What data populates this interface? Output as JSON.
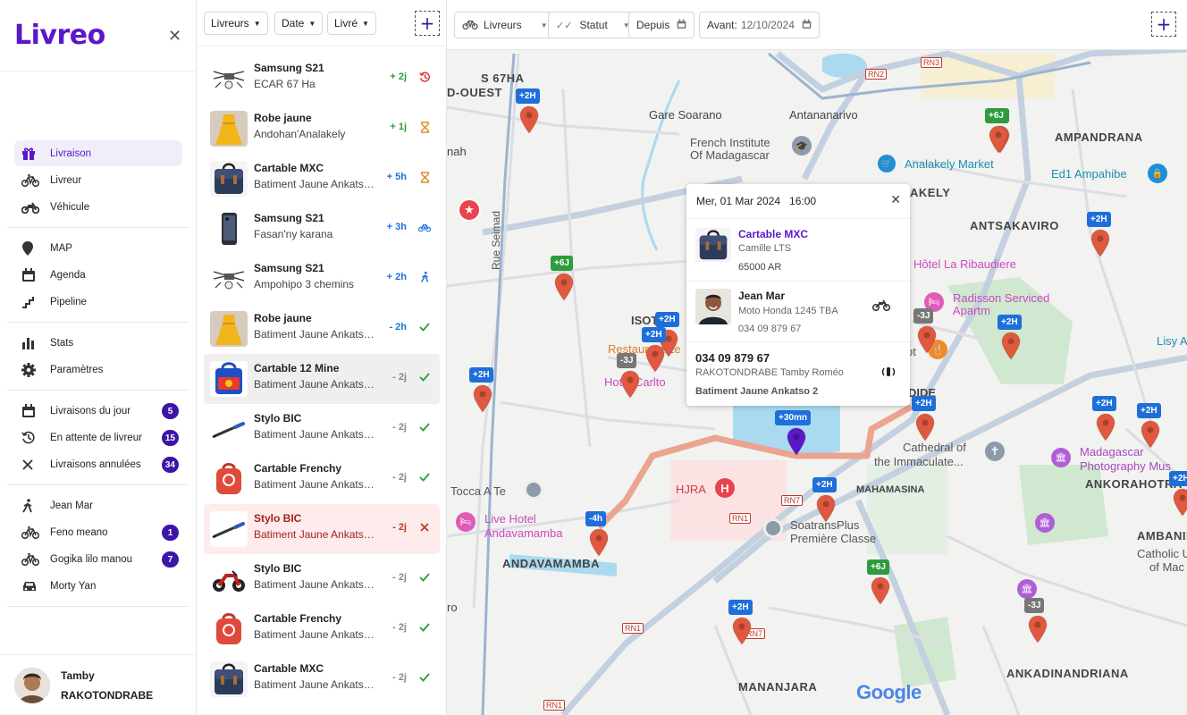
{
  "app": {
    "logo": "Livreo"
  },
  "sidebar": {
    "main": [
      {
        "label": "Livraison",
        "icon": "gift-icon",
        "active": true
      },
      {
        "label": "Livreur",
        "icon": "bicycle-icon"
      },
      {
        "label": "Véhicule",
        "icon": "motorbike-icon"
      }
    ],
    "tools": [
      {
        "label": "MAP",
        "icon": "map-pin-icon"
      },
      {
        "label": "Agenda",
        "icon": "calendar-icon"
      },
      {
        "label": "Pipeline",
        "icon": "pipeline-icon"
      }
    ],
    "settings": [
      {
        "label": "Stats",
        "icon": "bar-chart-icon"
      },
      {
        "label": "Paramètres",
        "icon": "gear-icon"
      }
    ],
    "queues": [
      {
        "label": "Livraisons du jour",
        "icon": "calendar-icon",
        "badge": "5"
      },
      {
        "label": "En attente de livreur",
        "icon": "history-icon",
        "badge": "15"
      },
      {
        "label": "Livraisons annulées",
        "icon": "close-icon",
        "badge": "34"
      }
    ],
    "couriers": [
      {
        "label": "Jean Mar",
        "icon": "walker-icon",
        "badge": ""
      },
      {
        "label": "Feno meano",
        "icon": "bicycle-icon",
        "badge": "1"
      },
      {
        "label": "Gogika lilo manou",
        "icon": "bicycle-icon",
        "badge": "7"
      },
      {
        "label": "Morty Yan",
        "icon": "car-icon",
        "badge": ""
      }
    ],
    "user": {
      "first": "Tamby",
      "last": "RAKOTONDRABE"
    }
  },
  "list_filters": {
    "livreurs": "Livreurs",
    "date": "Date",
    "livre": "Livré"
  },
  "deliveries": [
    {
      "title": "Samsung S21",
      "sub": "ECAR 67 Ha",
      "time": "+ 2j",
      "time_color": "#2e9b3c",
      "status": "history",
      "status_color": "#d33",
      "thumb": "drone"
    },
    {
      "title": "Robe jaune",
      "sub": "Andohan'Analakely",
      "time": "+ 1j",
      "time_color": "#2e9b3c",
      "status": "hourglass",
      "status_color": "#e08a2a",
      "thumb": "dress"
    },
    {
      "title": "Cartable MXC",
      "sub": "Batiment Jaune Ankatso 2",
      "time": "+ 5h",
      "time_color": "#1e6fd9",
      "status": "hourglass",
      "status_color": "#e08a2a",
      "thumb": "bag"
    },
    {
      "title": "Samsung S21",
      "sub": "Fasan'ny karana",
      "time": "+ 3h",
      "time_color": "#1e6fd9",
      "status": "bike",
      "status_color": "#1e6fd9",
      "thumb": "phone"
    },
    {
      "title": "Samsung S21",
      "sub": "Ampohipo 3 chemins",
      "time": "+ 2h",
      "time_color": "#1e6fd9",
      "status": "walk",
      "status_color": "#1e6fd9",
      "thumb": "drone"
    },
    {
      "title": "Robe jaune",
      "sub": "Batiment Jaune Ankatso 2",
      "time": "- 2h",
      "time_color": "#1e6fd9",
      "status": "check",
      "status_color": "#2e9b3c",
      "thumb": "dress"
    },
    {
      "title": "Cartable 12 Mine",
      "sub": "Batiment Jaune Ankatso 2",
      "time": "- 2j",
      "time_color": "#888",
      "status": "check",
      "status_color": "#2e9b3c",
      "thumb": "schoolbag",
      "selected": true
    },
    {
      "title": "Stylo BIC",
      "sub": "Batiment Jaune Ankatso 2",
      "time": "- 2j",
      "time_color": "#888",
      "status": "check",
      "status_color": "#2e9b3c",
      "thumb": "pen"
    },
    {
      "title": "Cartable Frenchy",
      "sub": "Batiment Jaune Ankatso 2",
      "time": "- 2j",
      "time_color": "#888",
      "status": "check",
      "status_color": "#2e9b3c",
      "thumb": "redbag"
    },
    {
      "title": "Stylo BIC",
      "sub": "Batiment Jaune Ankatso 2",
      "time": "- 2j",
      "time_color": "#c0392b",
      "status": "cross",
      "status_color": "#c0392b",
      "thumb": "pen",
      "error": true
    },
    {
      "title": "Stylo BIC",
      "sub": "Batiment Jaune Ankatso 2",
      "time": "- 2j",
      "time_color": "#888",
      "status": "check",
      "status_color": "#2e9b3c",
      "thumb": "moto"
    },
    {
      "title": "Cartable Frenchy",
      "sub": "Batiment Jaune Ankatso 2",
      "time": "- 2j",
      "time_color": "#888",
      "status": "check",
      "status_color": "#2e9b3c",
      "thumb": "redbag"
    },
    {
      "title": "Cartable MXC",
      "sub": "Batiment Jaune Ankatso 2",
      "time": "- 2j",
      "time_color": "#888",
      "status": "check",
      "status_color": "#2e9b3c",
      "thumb": "bag"
    }
  ],
  "map_filters": {
    "livreurs": "Livreurs",
    "statut": "Statut",
    "depuis": "Depuis",
    "avant_label": "Avant:",
    "avant_value": "12/10/2024"
  },
  "popup": {
    "datetime": "Mer, 01 Mar 2024   16:00",
    "product_title": "Cartable MXC",
    "product_vendor": "Camille LTS",
    "product_price": "65000 AR",
    "driver_name": "Jean Mar",
    "driver_vehicle": "Moto Honda 1245 TBA",
    "driver_phone": "034 09 879 67",
    "client_phone": "034 09 879 67",
    "client_name": "RAKOTONDRABE Tamby Roméo",
    "client_address": "Batiment Jaune Ankatso 2"
  },
  "map_labels": {
    "gare": "Gare Soarano",
    "antananarivo": "Antananarivo",
    "french1": "French Institute",
    "french2": "Of Madagascar",
    "analakely": "Analakely Market",
    "ampandrana": "AMPANDRANA",
    "ed1": "Ed1 Ampahibe",
    "antsakaviro": "ANTSAKAVIRO",
    "akely": "AKELY",
    "ribaudiere": "Hôtel La Ribaudiere",
    "radisson1": "Radisson Serviced",
    "radisson2": "Apartm",
    "lisy": "Lisy A",
    "isot": "ISOT",
    "restaurant": "Restaurant Le",
    "hotel": "Hotel Carlto",
    "ot": "ot",
    "cathedral1": "Cathedral of",
    "cathedral2": "the Immaculate...",
    "mada1": "Madagascar",
    "mada2": "Photography Mus",
    "tocca": "Tocca A Te",
    "hjra": "HJRA",
    "mahamasina": "MAHAMASINA",
    "ankorahotra": "ANKORAHOTRA",
    "live1": "Live Hotel",
    "live2": "Andavamamba",
    "soatrans1": "SoatransPlus",
    "soatrans2": "Première Classe",
    "andavamamba": "ANDAVAMAMBA",
    "ambanin": "AMBANIN",
    "catholic1": "Catholic U",
    "catholic2": "of Mac",
    "ankadin": "ANKADINANDRIANA",
    "mananjara": "MANANJARA",
    "ouest": "D-OUEST",
    "s67": "S 67HA",
    "mah": "nah",
    "rue": "Rue Seimad",
    "rn2": "RN2",
    "rn3": "RN3",
    "rn1a": "RN1",
    "rn7a": "RN7",
    "rn1b": "RN1",
    "rn7b": "RN7",
    "rn1c": "RN1",
    "google": "Google",
    "ro": "ro",
    "bide": "DIDE"
  },
  "pins": [
    {
      "label": "+2H",
      "color": "#1e6fd9"
    },
    {
      "label": "+6J",
      "color": "#2e9b3c"
    },
    {
      "label": "+2H",
      "color": "#1e6fd9"
    },
    {
      "label": "-3J",
      "color": "#777"
    },
    {
      "label": "+6J",
      "color": "#2e9b3c"
    },
    {
      "label": "+2H",
      "color": "#1e6fd9"
    },
    {
      "label": "-3J",
      "color": "#777"
    },
    {
      "label": "+2H",
      "color": "#1e6fd9"
    },
    {
      "label": "+2H",
      "color": "#1e6fd9"
    },
    {
      "label": "+2H",
      "color": "#1e6fd9"
    },
    {
      "label": "-3J",
      "color": "#777"
    },
    {
      "label": "+6J",
      "color": "#2e9b3c"
    },
    {
      "label": "+2H",
      "color": "#1e6fd9"
    },
    {
      "label": "+2H",
      "color": "#1e6fd9"
    },
    {
      "label": "+2H",
      "color": "#1e6fd9"
    },
    {
      "label": "-4h",
      "color": "#1e6fd9"
    },
    {
      "label": "+6J",
      "color": "#2e9b3c"
    },
    {
      "label": "+2H",
      "color": "#1e6fd9"
    },
    {
      "label": "-3J",
      "color": "#777"
    },
    {
      "label": "+30mn",
      "color": "#1e6fd9"
    },
    {
      "label": "+2H",
      "color": "#1e6fd9"
    },
    {
      "label": "+2H",
      "color": "#1e6fd9"
    }
  ],
  "colors": {
    "brand": "#5b17c9",
    "badge": "#3f14a8",
    "pin": "#e0593f",
    "route": "#eaa48f",
    "water": "#aadaf0",
    "road": "#b7c9e0"
  }
}
